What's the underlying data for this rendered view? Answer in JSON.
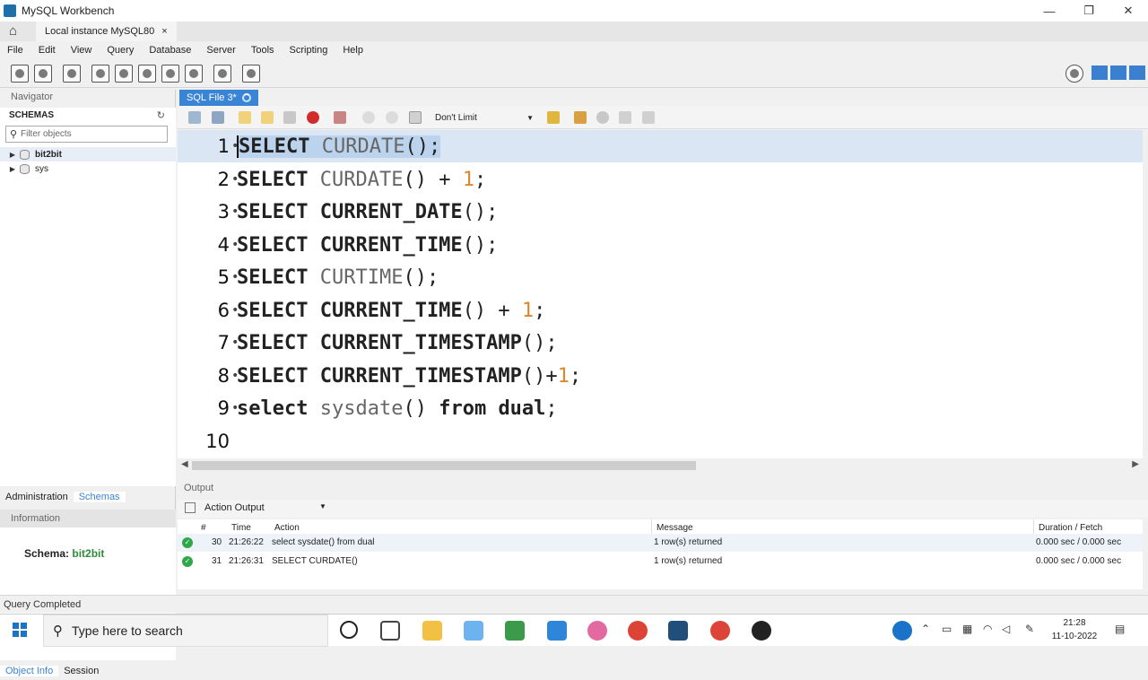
{
  "window": {
    "title": "MySQL Workbench",
    "min": "—",
    "restore": "❐",
    "close": "✕"
  },
  "conn_tab": {
    "label": "Local instance MySQL80",
    "close": "×"
  },
  "menu": [
    "File",
    "Edit",
    "View",
    "Query",
    "Database",
    "Server",
    "Tools",
    "Scripting",
    "Help"
  ],
  "navigator": {
    "header": "Navigator",
    "schemas_label": "SCHEMAS",
    "filter_placeholder": "Filter objects",
    "schemas": [
      "bit2bit",
      "sys"
    ],
    "tabs": [
      "Administration",
      "Schemas"
    ],
    "info_header": "Information",
    "info_schema_label": "Schema:",
    "info_schema_value": "bit2bit",
    "bottom_tabs": [
      "Object Info",
      "Session"
    ]
  },
  "sql_tab": {
    "label": "SQL File 3*"
  },
  "editor_toolbar": {
    "limit": "Don't Limit"
  },
  "code_lines": [
    {
      "n": "1",
      "text": "SELECT CURDATE();"
    },
    {
      "n": "2",
      "text": "SELECT CURDATE() + 1;"
    },
    {
      "n": "3",
      "text": "SELECT CURRENT_DATE();"
    },
    {
      "n": "4",
      "text": "SELECT CURRENT_TIME();"
    },
    {
      "n": "5",
      "text": "SELECT CURTIME();"
    },
    {
      "n": "6",
      "text": "SELECT CURRENT_TIME() + 1;"
    },
    {
      "n": "7",
      "text": "SELECT CURRENT_TIMESTAMP();"
    },
    {
      "n": "8",
      "text": "SELECT CURRENT_TIMESTAMP()+1;"
    },
    {
      "n": "9",
      "text": "select sysdate() from dual;"
    },
    {
      "n": "10",
      "text": ""
    }
  ],
  "output": {
    "header": "Output",
    "selector": "Action Output",
    "columns": [
      "#",
      "Time",
      "Action",
      "Message",
      "Duration / Fetch"
    ],
    "rows": [
      {
        "num": "30",
        "time": "21:26:22",
        "action": "select sysdate() from dual",
        "message": "1 row(s) returned",
        "duration": "0.000 sec / 0.000 sec"
      },
      {
        "num": "31",
        "time": "21:26:31",
        "action": "SELECT CURDATE()",
        "message": "1 row(s) returned",
        "duration": "0.000 sec / 0.000 sec"
      }
    ]
  },
  "status": "Query Completed",
  "taskbar": {
    "search_placeholder": "Type here to search",
    "time": "21:28",
    "date": "11-10-2022"
  }
}
